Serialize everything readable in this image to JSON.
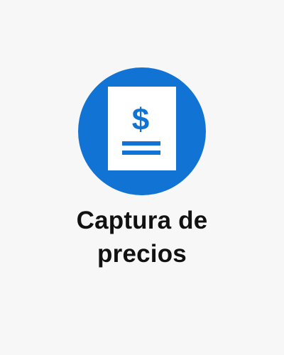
{
  "tile": {
    "title_line1": "Captura de",
    "title_line2": "precios",
    "icon_name": "price-document-icon",
    "icon_glyph": "$"
  },
  "colors": {
    "background": "#f7f7f7",
    "accent": "#1173d4",
    "document": "#ffffff",
    "text": "#111111"
  }
}
